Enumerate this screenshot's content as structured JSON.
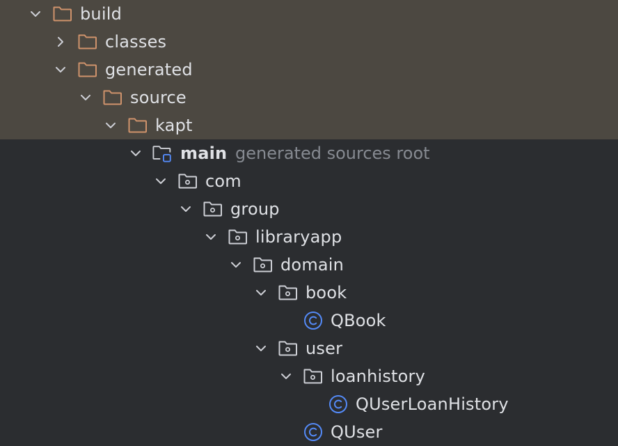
{
  "colors": {
    "excluded_background": "#4c4841",
    "panel_background": "#2b2d30",
    "excluded_folder": "#d0936c",
    "package_folder": "#ced0d6",
    "source_root_marker": "#548af7",
    "class_icon": "#548af7",
    "text": "#dfe1e5",
    "hint_text": "#868a91"
  },
  "tree": [
    {
      "depth": 0,
      "label": "build",
      "icon": "excluded-folder-icon",
      "state": "expanded",
      "excluded": true
    },
    {
      "depth": 1,
      "label": "classes",
      "icon": "excluded-folder-icon",
      "state": "collapsed",
      "excluded": true
    },
    {
      "depth": 1,
      "label": "generated",
      "icon": "excluded-folder-icon",
      "state": "expanded",
      "excluded": true
    },
    {
      "depth": 2,
      "label": "source",
      "icon": "excluded-folder-icon",
      "state": "expanded",
      "excluded": true
    },
    {
      "depth": 3,
      "label": "kapt",
      "icon": "excluded-folder-icon",
      "state": "expanded",
      "excluded": true
    },
    {
      "depth": 4,
      "label": "main",
      "hint": "generated sources root",
      "icon": "generated-source-root-icon",
      "state": "expanded",
      "bold": true
    },
    {
      "depth": 5,
      "label": "com",
      "icon": "package-folder-icon",
      "state": "expanded"
    },
    {
      "depth": 6,
      "label": "group",
      "icon": "package-folder-icon",
      "state": "expanded"
    },
    {
      "depth": 7,
      "label": "libraryapp",
      "icon": "package-folder-icon",
      "state": "expanded"
    },
    {
      "depth": 8,
      "label": "domain",
      "icon": "package-folder-icon",
      "state": "expanded"
    },
    {
      "depth": 9,
      "label": "book",
      "icon": "package-folder-icon",
      "state": "expanded"
    },
    {
      "depth": 10,
      "label": "QBook",
      "icon": "class-icon",
      "state": "leaf"
    },
    {
      "depth": 9,
      "label": "user",
      "icon": "package-folder-icon",
      "state": "expanded"
    },
    {
      "depth": 10,
      "label": "loanhistory",
      "icon": "package-folder-icon",
      "state": "expanded"
    },
    {
      "depth": 11,
      "label": "QUserLoanHistory",
      "icon": "class-icon",
      "state": "leaf"
    },
    {
      "depth": 10,
      "label": "QUser",
      "icon": "class-icon",
      "state": "leaf"
    }
  ]
}
